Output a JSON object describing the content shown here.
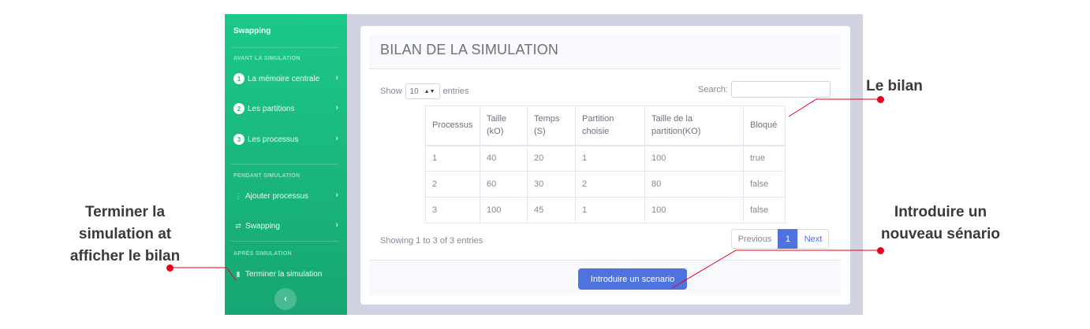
{
  "sidebar": {
    "brand": "Swapping",
    "sections": {
      "before": "AVANT LA SIMULATION",
      "during": "PENDANT SIMULATION",
      "after": "APRÉS SIMULATION"
    },
    "items": [
      {
        "num": "1",
        "label": "La mémoire centrale",
        "icon": "number-badge-icon"
      },
      {
        "num": "2",
        "label": "Les partitions",
        "icon": "number-badge-icon"
      },
      {
        "num": "3",
        "label": "Les processus",
        "icon": "number-badge-icon"
      },
      {
        "label": "Ajouter processus",
        "icon": "dots-vertical-icon"
      },
      {
        "label": "Swapping",
        "icon": "exchange-arrows-icon"
      },
      {
        "label": "Terminer la simulation",
        "icon": "document-icon"
      }
    ],
    "toggle_icon": "chevron-left-icon"
  },
  "card": {
    "title": "BILAN DE LA SIMULATION",
    "show_label": "Show",
    "entries_label": "entries",
    "length_value": "10",
    "search_label": "Search:",
    "info": "Showing 1 to 3 of 3 entries",
    "pagination": {
      "previous": "Previous",
      "current": "1",
      "next": "Next"
    },
    "button": "Introduire un scenario"
  },
  "table": {
    "headers": [
      "Processus",
      "Taille (kO)",
      "Temps (S)",
      "Partition choisie",
      "Taille de la partition(KO)",
      "Bloqué"
    ],
    "rows": [
      [
        "1",
        "40",
        "20",
        "1",
        "100",
        "true"
      ],
      [
        "2",
        "60",
        "30",
        "2",
        "80",
        "false"
      ],
      [
        "3",
        "100",
        "45",
        "1",
        "100",
        "false"
      ]
    ]
  },
  "annotations": {
    "bilan": "Le bilan",
    "terminer": "Terminer la simulation at afficher le bilan",
    "introduire": "Introduire un nouveau sénario"
  },
  "colors": {
    "sidebar_green": "#1cc88a",
    "primary_blue": "#4e73df",
    "annotation_red": "#e8001c"
  }
}
